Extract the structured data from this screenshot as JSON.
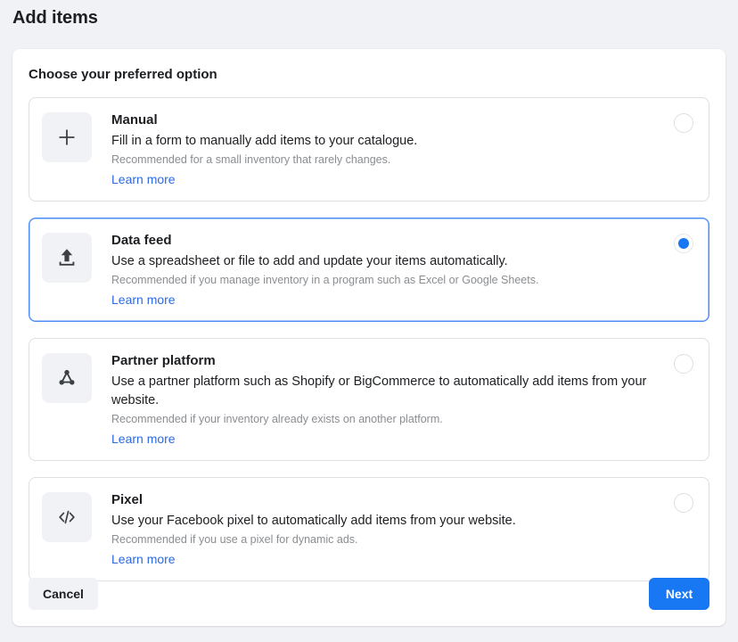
{
  "page": {
    "title": "Add items"
  },
  "panel": {
    "heading": "Choose your preferred option"
  },
  "colors": {
    "accent": "#1877f2",
    "selected_border": "#4a8df8",
    "link": "#2d6ae0",
    "page_background": "#f0f2f5",
    "card_background": "#ffffff",
    "muted_text": "#8a8d91",
    "primary_text": "#1c1e21"
  },
  "options": [
    {
      "id": "manual",
      "icon": "plus-icon",
      "title": "Manual",
      "description": "Fill in a form to manually add items to your catalogue.",
      "note": "Recommended for a small inventory that rarely changes.",
      "link_label": "Learn more",
      "selected": false
    },
    {
      "id": "data-feed",
      "icon": "upload-icon",
      "title": "Data feed",
      "description": "Use a spreadsheet or file to add and update your items automatically.",
      "note": "Recommended if you manage inventory in a program such as Excel or Google Sheets.",
      "link_label": "Learn more",
      "selected": true
    },
    {
      "id": "partner-platform",
      "icon": "network-nodes-icon",
      "title": "Partner platform",
      "description": "Use a partner platform such as Shopify or BigCommerce to automatically add items from your website.",
      "note": "Recommended if your inventory already exists on another platform.",
      "link_label": "Learn more",
      "selected": false
    },
    {
      "id": "pixel",
      "icon": "code-icon",
      "title": "Pixel",
      "description": "Use your Facebook pixel to automatically add items from your website.",
      "note": "Recommended if you use a pixel for dynamic ads.",
      "link_label": "Learn more",
      "selected": false
    }
  ],
  "footer": {
    "cancel_label": "Cancel",
    "next_label": "Next"
  }
}
